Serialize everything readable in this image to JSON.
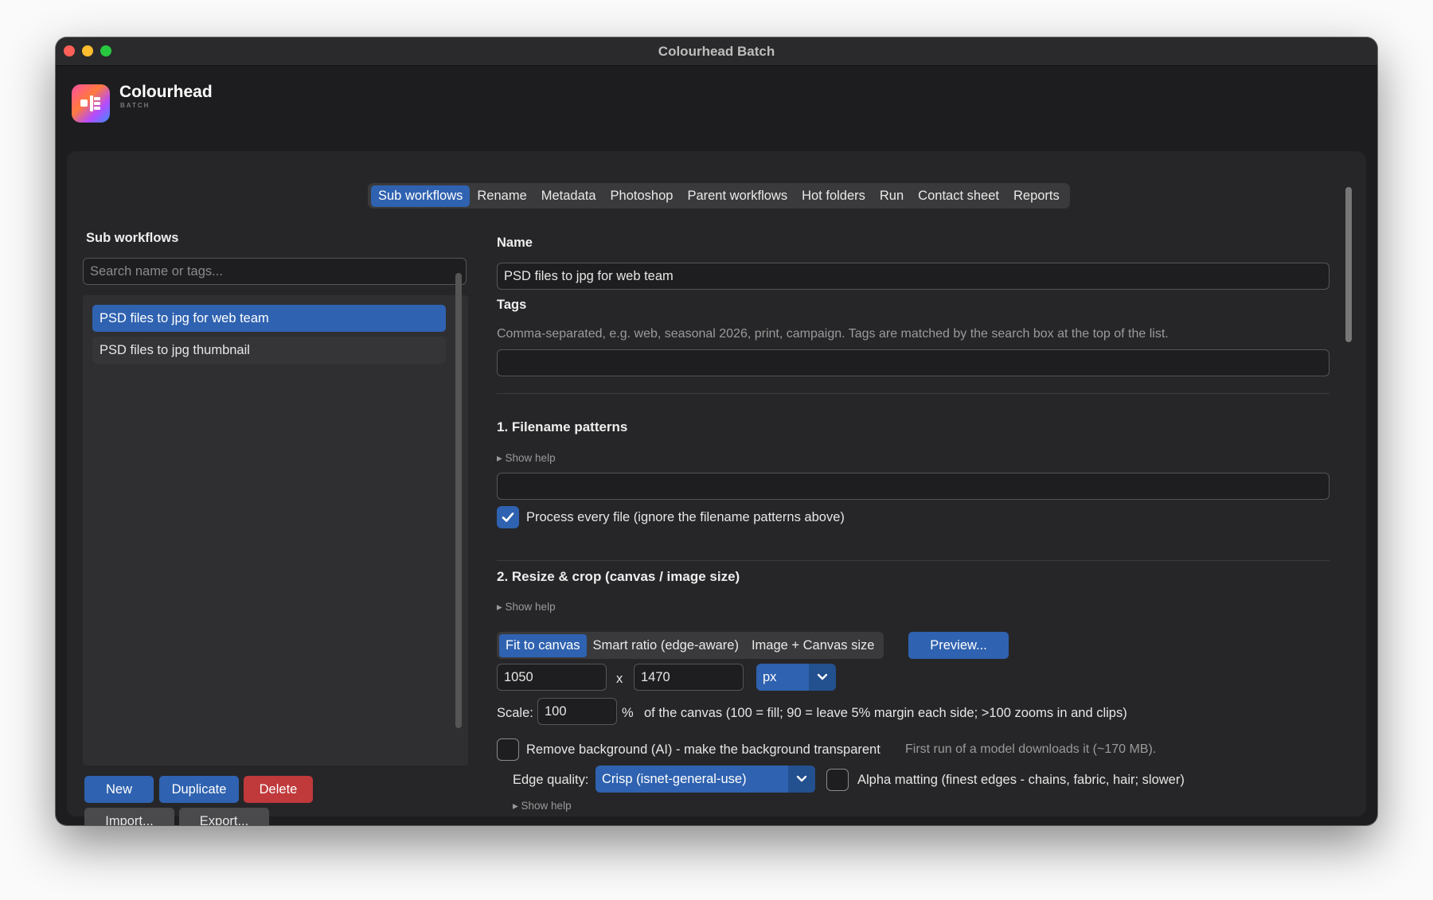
{
  "window": {
    "title": "Colourhead Batch"
  },
  "brand": {
    "name": "Colourhead",
    "subtitle": "BATCH"
  },
  "tabs": [
    {
      "label": "Sub workflows",
      "active": true
    },
    {
      "label": "Rename"
    },
    {
      "label": "Metadata"
    },
    {
      "label": "Photoshop"
    },
    {
      "label": "Parent workflows"
    },
    {
      "label": "Hot folders"
    },
    {
      "label": "Run"
    },
    {
      "label": "Contact sheet"
    },
    {
      "label": "Reports"
    }
  ],
  "sidebar": {
    "title": "Sub workflows",
    "search_placeholder": "Search name or tags...",
    "items": [
      {
        "label": "PSD files to jpg for web team",
        "selected": true
      },
      {
        "label": "PSD files to jpg thumbnail"
      }
    ],
    "buttons": {
      "new": "New",
      "duplicate": "Duplicate",
      "delete": "Delete",
      "import": "Import...",
      "export": "Export..."
    }
  },
  "form": {
    "name_label": "Name",
    "name_value": "PSD files to jpg for web team",
    "tags_label": "Tags",
    "tags_hint": "Comma-separated, e.g.  web, seasonal 2026, print, campaign. Tags are matched by the search box at the top of the list.",
    "tags_value": "",
    "section1": {
      "title": "1. Filename patterns",
      "show_help": "▸ Show help",
      "patterns_value": "",
      "process_every_label": "Process every file (ignore the filename patterns above)",
      "process_every_checked": true
    },
    "section2": {
      "title": "2. Resize & crop (canvas / image size)",
      "show_help": "▸ Show help",
      "modes": [
        {
          "label": "Fit to canvas",
          "active": true
        },
        {
          "label": "Smart ratio (edge-aware)"
        },
        {
          "label": "Image + Canvas size"
        }
      ],
      "preview_button": "Preview...",
      "width": "1050",
      "times": "x",
      "height": "1470",
      "unit": "px",
      "scale_label": "Scale:",
      "scale_value": "100",
      "percent": "%",
      "scale_hint": "of the canvas (100 = fill; 90 = leave 5% margin each side; >100 zooms in and clips)",
      "remove_bg_label": "Remove background (AI) - make the background transparent",
      "remove_bg_checked": false,
      "remove_bg_hint": "First run of a model downloads it (~170 MB).",
      "edge_quality_label": "Edge quality:",
      "edge_quality_value": "Crisp (isnet-general-use)",
      "alpha_matting_label": "Alpha matting (finest edges - chains, fabric, hair; slower)",
      "alpha_matting_checked": false,
      "show_help_2": "▸ Show help"
    }
  },
  "colors": {
    "accent": "#2f62b0",
    "danger": "#c0393b",
    "window_bg": "#1d1d1f",
    "panel_bg": "#262628"
  },
  "icons": {
    "close": "close-traffic-light",
    "minimize": "minimize-traffic-light",
    "maximize": "maximize-traffic-light",
    "logo": "colourhead-logo-icon",
    "checkmark": "checkmark-icon",
    "chevron": "chevron-down-icon"
  }
}
